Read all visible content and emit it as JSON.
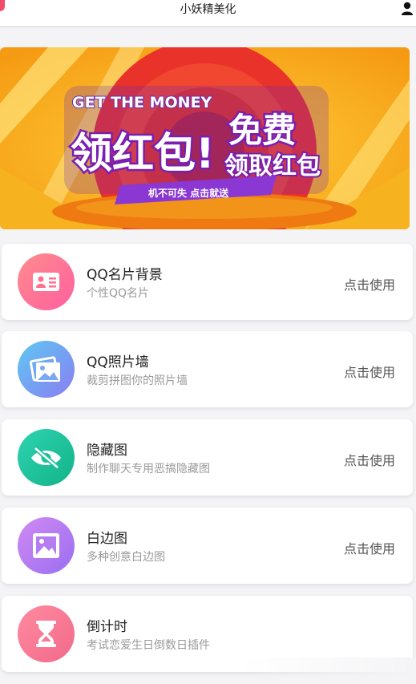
{
  "header": {
    "title": "小妖精美化",
    "user_icon": "user-icon"
  },
  "banner": {
    "top_text": "GET THE MONEY",
    "main_text": "领红包!",
    "free_text": "免费",
    "sub_text": "领取红包",
    "ribbon_text": "机不可失 点击就送",
    "colors": {
      "orange": "#f7a21c",
      "red": "#e9322a",
      "purple": "#6a2bb8",
      "gold": "#ffd23f"
    }
  },
  "features": [
    {
      "name": "QQ名片背景",
      "desc": "个性QQ名片",
      "action": "点击使用",
      "icon": "id-card-icon",
      "gradient": [
        "#ff8c8c",
        "#ff5fa0"
      ]
    },
    {
      "name": "QQ照片墙",
      "desc": "裁剪拼图你的照片墙",
      "action": "点击使用",
      "icon": "photo-wall-icon",
      "gradient": [
        "#5ec8f2",
        "#8a7df2"
      ]
    },
    {
      "name": "隐藏图",
      "desc": "制作聊天专用恶搞隐藏图",
      "action": "点击使用",
      "icon": "eye-off-icon",
      "gradient": [
        "#2ed3b0",
        "#12b388"
      ]
    },
    {
      "name": "白边图",
      "desc": "多种创意白边图",
      "action": "点击使用",
      "icon": "image-frame-icon",
      "gradient": [
        "#d08af2",
        "#9a6ef2"
      ]
    },
    {
      "name": "倒计时",
      "desc": "考试恋爱生日倒数日插件",
      "action": "",
      "icon": "hourglass-icon",
      "gradient": [
        "#ff8aa0",
        "#f26a8a"
      ]
    }
  ]
}
